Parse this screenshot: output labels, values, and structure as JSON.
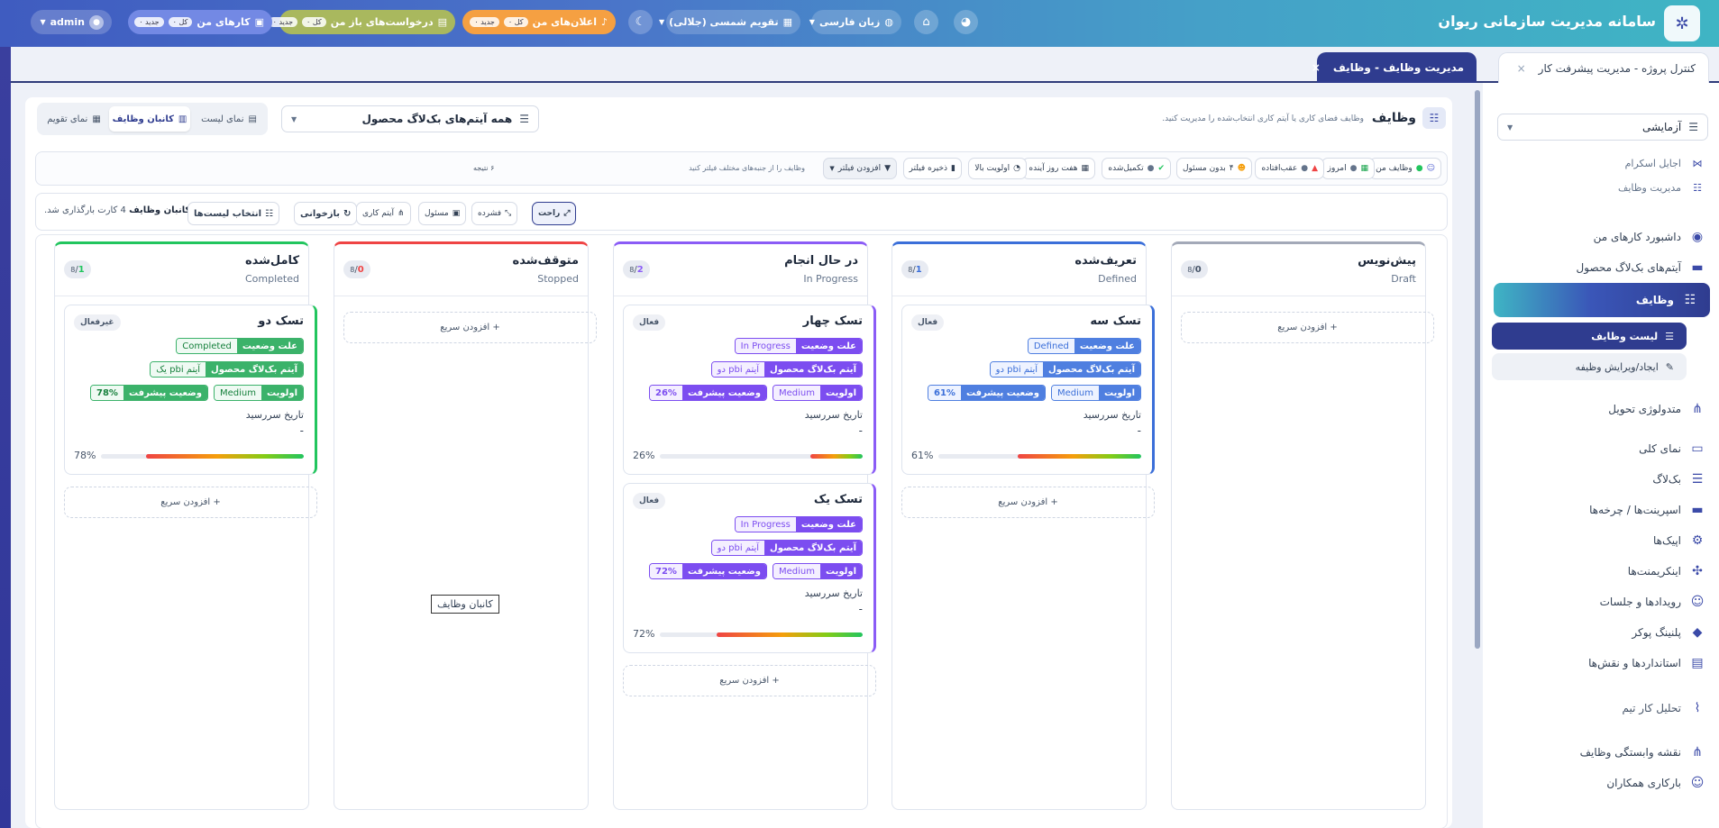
{
  "header": {
    "app_title": "سامانه مدیریت سازمانی ریوان",
    "language_label": "زبان  فارسی",
    "calendar_label": "تقویم  شمسی (جلالی)",
    "announcements": {
      "label": "اعلان‌های من",
      "all": "کل",
      "new": "جدید",
      "all_count": "۰",
      "new_count": "۰"
    },
    "open_requests": {
      "label": "درخواست‌های باز من",
      "all": "کل",
      "new": "جدید",
      "all_count": "۰",
      "new_count": "۰"
    },
    "my_tasks": {
      "label": "کارهای من",
      "all": "کل",
      "new": "جدید",
      "all_count": "۰",
      "new_count": "۰"
    },
    "user_label": "admin"
  },
  "tabs": [
    {
      "label": "کنترل پروژه  -  مدیریت پیشرفت کار",
      "close": "×",
      "active": false
    },
    {
      "label": "مدیریت وظایف  -  وظایف",
      "close": "×",
      "active": true
    }
  ],
  "sidebar": {
    "project_select": "آزمایشی",
    "section_items": [
      {
        "label": "اجایل اسکرام",
        "icon": "scrum-icon"
      },
      {
        "label": "مدیریت وظایف",
        "icon": "tasks-icon"
      }
    ],
    "items": [
      {
        "label": "داشبورد کارهای من",
        "icon": "dashboard-icon"
      },
      {
        "label": "آیتم‌های بک‌لاگ محصول",
        "icon": "backlog-items-icon"
      },
      {
        "label": "وظایف",
        "icon": "tasks-icon",
        "active": true
      },
      {
        "label": "لیست وظایف",
        "icon": "list-icon",
        "sub": true,
        "active": true
      },
      {
        "label": "ایجاد/ویرایش وظیفه",
        "icon": "edit-icon",
        "sub": true
      },
      {
        "label": "متدولوژی تحویل",
        "icon": "methodology-icon"
      },
      {
        "label": "نمای کلی",
        "icon": "overview-icon"
      },
      {
        "label": "بک‌لاگ",
        "icon": "backlog-icon"
      },
      {
        "label": "اسپرینت‌ها / چرخه‌ها",
        "icon": "sprints-icon"
      },
      {
        "label": "اپیک‌ها",
        "icon": "epics-icon"
      },
      {
        "label": "اینکریمنت‌ها",
        "icon": "increments-icon"
      },
      {
        "label": "رویدادها و جلسات",
        "icon": "events-icon"
      },
      {
        "label": "پلنینگ پوکر",
        "icon": "poker-icon"
      },
      {
        "label": "استانداردها و نقش‌ها",
        "icon": "standards-icon"
      },
      {
        "label": "تحلیل کار تیم",
        "icon": "analytics-icon"
      },
      {
        "label": "نقشه وابستگی وظایف",
        "icon": "dependency-icon"
      },
      {
        "label": "بارکاری همکاران",
        "icon": "workload-icon"
      }
    ]
  },
  "main": {
    "title": "وظایف",
    "subtitle": "وظایف فضای کاری یا آیتم کاری انتخاب‌شده را مدیریت کنید.",
    "backlog_select": "همه آیتم‌های بک‌لاگ محصول",
    "views": {
      "list": "نمای لیست",
      "kanban": "کانبان وظایف",
      "calendar": "نمای تقویم"
    },
    "filters": {
      "chips": [
        "وظایف من",
        "امروز",
        "عقب‌افتاده",
        "بدون مسئول",
        "تکمیل‌شده",
        "هفت روز آینده",
        "اولویت بالا",
        "ذخیره فیلتر"
      ],
      "no_owner_count": "۴",
      "add_filter": "افزودن فیلتر",
      "hint": "وظایف را از جنبه‌های مختلف فیلتر کنید",
      "results": "۶ نتیجه"
    },
    "kanban_bar": {
      "title": "کانبان وظایف",
      "status": "4 کارت بارگذاری شد.",
      "choose_lists": "انتخاب لیست‌ها",
      "reload": "بازخوانی",
      "work_item": "آیتم کاری",
      "owner": "مسئول",
      "compact": "فشرده",
      "comfortable": "راحت"
    },
    "empty_label": "کانبان وظایف",
    "quick_add": "+ افزودن سریع",
    "columns": [
      {
        "title": "پیش‌نویس",
        "subtitle": "Draft",
        "count": "0",
        "total": "8",
        "color": "#a3a9b8",
        "cards": []
      },
      {
        "title": "تعریف‌شده",
        "subtitle": "Defined",
        "count": "1",
        "total": "8",
        "color": "#3b6fd9",
        "cards": [
          {
            "title": "تسک سه",
            "badge": "فعال",
            "status_key": "علت وضعیت",
            "status": "Defined",
            "pbi_key": "آیتم بک‌لاگ محصول",
            "pbi": "آیتم pbi دو",
            "priority_key": "اولویت",
            "priority": "Medium",
            "progress_key": "وضعیت پیشرفت",
            "progress_label": "61%",
            "progress": 61,
            "due_label": "تاریخ سررسید",
            "due": "-",
            "accent": "#3b6fd9",
            "tagcolor": "#4f7fe0"
          }
        ]
      },
      {
        "title": "در حال انجام",
        "subtitle": "In Progress",
        "count": "2",
        "total": "8",
        "color": "#8b5cf6",
        "cards": [
          {
            "title": "تسک چهار",
            "badge": "فعال",
            "status_key": "علت وضعیت",
            "status": "In Progress",
            "pbi_key": "آیتم بک‌لاگ محصول",
            "pbi": "آیتم pbi دو",
            "priority_key": "اولویت",
            "priority": "Medium",
            "progress_key": "وضعیت پیشرفت",
            "progress_label": "26%",
            "progress": 26,
            "due_label": "تاریخ سررسید",
            "due": "-",
            "accent": "#8b5cf6",
            "tagcolor": "#7c4df0"
          },
          {
            "title": "تسک یک",
            "badge": "فعال",
            "status_key": "علت وضعیت",
            "status": "In Progress",
            "pbi_key": "آیتم بک‌لاگ محصول",
            "pbi": "آیتم pbi دو",
            "priority_key": "اولویت",
            "priority": "Medium",
            "progress_key": "وضعیت پیشرفت",
            "progress_label": "72%",
            "progress": 72,
            "due_label": "تاریخ سررسید",
            "due": "-",
            "accent": "#8b5cf6",
            "tagcolor": "#7c4df0"
          }
        ]
      },
      {
        "title": "متوقف‌شده",
        "subtitle": "Stopped",
        "count": "0",
        "total": "8",
        "color": "#ef4444",
        "cards": []
      },
      {
        "title": "کامل‌شده",
        "subtitle": "Completed",
        "count": "1",
        "total": "8",
        "color": "#22c55e",
        "cards": [
          {
            "title": "تسک دو",
            "badge": "غیرفعال",
            "status_key": "علت وضعیت",
            "status": "Completed",
            "pbi_key": "آیتم بک‌لاگ محصول",
            "pbi": "آیتم pbi یک",
            "priority_key": "اولویت",
            "priority": "Medium",
            "progress_key": "وضعیت پیشرفت",
            "progress_label": "78%",
            "progress": 78,
            "due_label": "تاریخ سررسید",
            "due": "-",
            "accent": "#22c55e",
            "tagcolor": "#3bb26a"
          }
        ]
      }
    ]
  }
}
